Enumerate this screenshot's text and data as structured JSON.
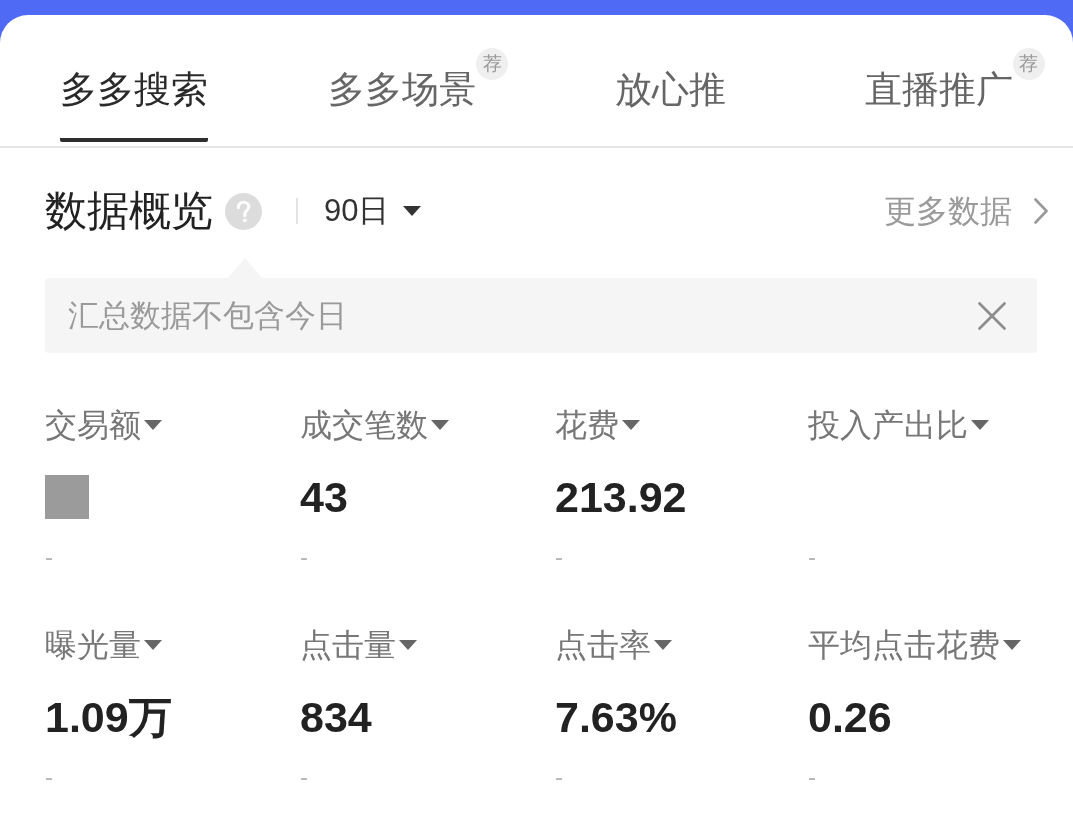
{
  "tabs": [
    {
      "label": "多多搜索",
      "selected": true
    },
    {
      "label": "多多场景",
      "selected": false,
      "badge": "荐"
    },
    {
      "label": "放心推",
      "selected": false
    },
    {
      "label": "直播推广",
      "selected": false,
      "badge": "荐"
    }
  ],
  "overview": {
    "title": "数据概览",
    "period": "90日",
    "more_link": "更多数据"
  },
  "notice": {
    "text": "汇总数据不包含今日"
  },
  "metrics": [
    {
      "label": "交易额",
      "kind": "redacted",
      "comparison": "-"
    },
    {
      "label": "成交笔数",
      "kind": "number",
      "value": "43",
      "comparison": "-"
    },
    {
      "label": "花费",
      "kind": "number",
      "value": "213.92",
      "comparison": "-"
    },
    {
      "label": "投入产出比",
      "kind": "empty",
      "comparison": "-"
    },
    {
      "label": "曝光量",
      "kind": "number",
      "value": "1.09万",
      "comparison": "-"
    },
    {
      "label": "点击量",
      "kind": "number",
      "value": "834",
      "comparison": "-"
    },
    {
      "label": "点击率",
      "kind": "number",
      "value": "7.63%",
      "comparison": "-"
    },
    {
      "label": "平均点击花费",
      "kind": "number",
      "value": "0.26",
      "comparison": "-"
    }
  ]
}
